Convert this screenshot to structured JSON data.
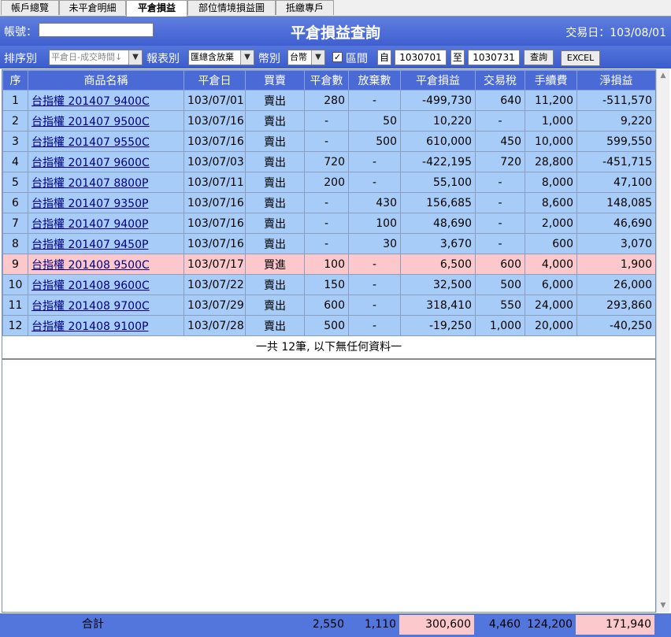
{
  "tabs": [
    "帳戶總覽",
    "未平倉明細",
    "平倉損益",
    "部位情境損益圖",
    "抵繳專戶"
  ],
  "active_tab": 2,
  "header": {
    "account_label": "帳號：",
    "title": "平倉損益查詢",
    "trade_date": "交易日：103/08/01"
  },
  "filters": {
    "sort_label": "排序別",
    "sort_value": "平倉日-成交時間↓",
    "report_label": "報表別",
    "report_value": "匯總含放棄",
    "currency_label": "幣別",
    "currency_value": "台幣",
    "interval_checked": "✓",
    "interval_label": "區間",
    "from_label": "自",
    "from_value": "1030701",
    "to_label": "至",
    "to_value": "1030731",
    "query_button": "查詢",
    "excel_button": "EXCEL"
  },
  "columns": [
    "序",
    "商品名稱",
    "平倉日",
    "買賣",
    "平倉數",
    "放棄數",
    "平倉損益",
    "交易稅",
    "手續費",
    "淨損益"
  ],
  "rows": [
    {
      "seq": "1",
      "name": "台指權 201407 9400C",
      "date": "103/07/01",
      "side": "賣出",
      "close_qty": "280",
      "abandon_qty": "-",
      "pnl": "-499,730",
      "tax": "640",
      "fee": "11,200",
      "net": "-511,570",
      "buy": false
    },
    {
      "seq": "2",
      "name": "台指權 201407 9500C",
      "date": "103/07/16",
      "side": "賣出",
      "close_qty": "-",
      "abandon_qty": "50",
      "pnl": "10,220",
      "tax": "-",
      "fee": "1,000",
      "net": "9,220",
      "buy": false
    },
    {
      "seq": "3",
      "name": "台指權 201407 9550C",
      "date": "103/07/16",
      "side": "賣出",
      "close_qty": "-",
      "abandon_qty": "500",
      "pnl": "610,000",
      "tax": "450",
      "fee": "10,000",
      "net": "599,550",
      "buy": false
    },
    {
      "seq": "4",
      "name": "台指權 201407 9600C",
      "date": "103/07/03",
      "side": "賣出",
      "close_qty": "720",
      "abandon_qty": "-",
      "pnl": "-422,195",
      "tax": "720",
      "fee": "28,800",
      "net": "-451,715",
      "buy": false
    },
    {
      "seq": "5",
      "name": "台指權 201407 8800P",
      "date": "103/07/11",
      "side": "賣出",
      "close_qty": "200",
      "abandon_qty": "-",
      "pnl": "55,100",
      "tax": "-",
      "fee": "8,000",
      "net": "47,100",
      "buy": false
    },
    {
      "seq": "6",
      "name": "台指權 201407 9350P",
      "date": "103/07/16",
      "side": "賣出",
      "close_qty": "-",
      "abandon_qty": "430",
      "pnl": "156,685",
      "tax": "-",
      "fee": "8,600",
      "net": "148,085",
      "buy": false
    },
    {
      "seq": "7",
      "name": "台指權 201407 9400P",
      "date": "103/07/16",
      "side": "賣出",
      "close_qty": "-",
      "abandon_qty": "100",
      "pnl": "48,690",
      "tax": "-",
      "fee": "2,000",
      "net": "46,690",
      "buy": false
    },
    {
      "seq": "8",
      "name": "台指權 201407 9450P",
      "date": "103/07/16",
      "side": "賣出",
      "close_qty": "-",
      "abandon_qty": "30",
      "pnl": "3,670",
      "tax": "-",
      "fee": "600",
      "net": "3,070",
      "buy": false
    },
    {
      "seq": "9",
      "name": "台指權 201408 9500C",
      "date": "103/07/17",
      "side": "買進",
      "close_qty": "100",
      "abandon_qty": "-",
      "pnl": "6,500",
      "tax": "600",
      "fee": "4,000",
      "net": "1,900",
      "buy": true
    },
    {
      "seq": "10",
      "name": "台指權 201408 9600C",
      "date": "103/07/22",
      "side": "賣出",
      "close_qty": "150",
      "abandon_qty": "-",
      "pnl": "32,500",
      "tax": "500",
      "fee": "6,000",
      "net": "26,000",
      "buy": false
    },
    {
      "seq": "11",
      "name": "台指權 201408 9700C",
      "date": "103/07/29",
      "side": "賣出",
      "close_qty": "600",
      "abandon_qty": "-",
      "pnl": "318,410",
      "tax": "550",
      "fee": "24,000",
      "net": "293,860",
      "buy": false
    },
    {
      "seq": "12",
      "name": "台指權 201408 9100P",
      "date": "103/07/28",
      "side": "賣出",
      "close_qty": "500",
      "abandon_qty": "-",
      "pnl": "-19,250",
      "tax": "1,000",
      "fee": "20,000",
      "net": "-40,250",
      "buy": false
    }
  ],
  "end_note": "一共 12筆, 以下無任何資料一",
  "totals": {
    "label": "合計",
    "close_qty": "2,550",
    "abandon_qty": "1,110",
    "pnl": "300,600",
    "tax": "4,460",
    "fee": "124,200",
    "net": "171,940"
  },
  "colors": {
    "header_blue": "#4a6ad6",
    "row_blue": "#a8ccf8",
    "row_pink": "#fcc8cc"
  }
}
